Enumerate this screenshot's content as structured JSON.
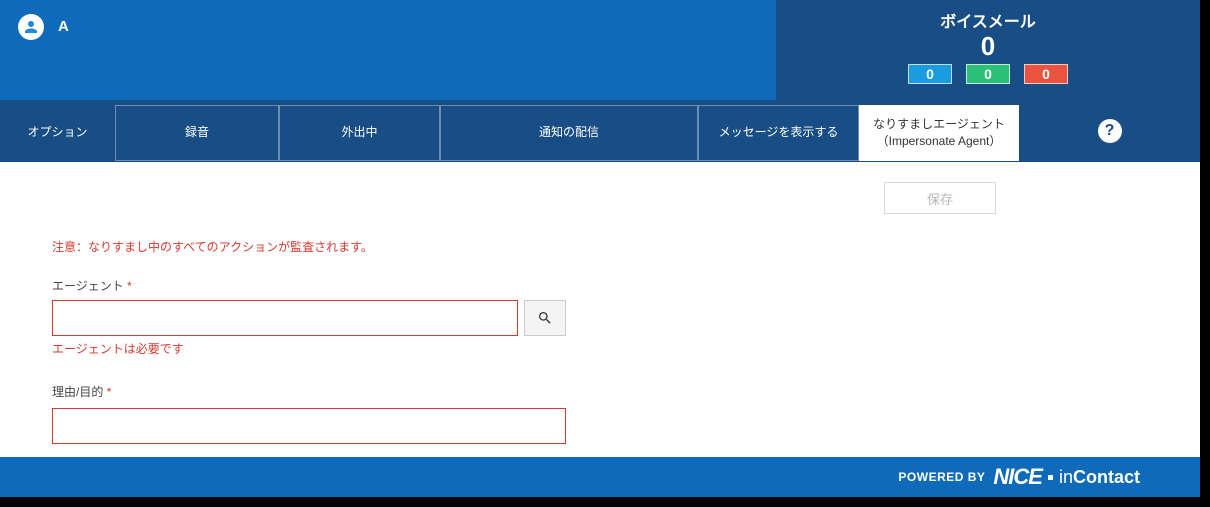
{
  "header": {
    "user_label": "A",
    "voicemail_title": "ボイスメール",
    "voicemail_count": "0",
    "badges": {
      "blue": "0",
      "green": "0",
      "red": "0"
    }
  },
  "nav": {
    "options_label": "オプション",
    "tabs": [
      {
        "label": "録音"
      },
      {
        "label": "外出中"
      },
      {
        "label": "通知の配信"
      },
      {
        "label": "メッセージを表示する"
      },
      {
        "label": "なりすましエージェント（Impersonate Agent）"
      }
    ],
    "help": "?"
  },
  "content": {
    "save_label": "保存",
    "warning_text": "注意：なりすまし中のすべてのアクションが監査されます。",
    "agent_label": "エージェント",
    "agent_error": "エージェントは必要です",
    "reason_label": "理由/目的",
    "required_mark": "*"
  },
  "footer": {
    "powered_by": "POWERED BY",
    "brand_nice": "NICE",
    "brand_in": "in",
    "brand_contact": "Contact"
  }
}
